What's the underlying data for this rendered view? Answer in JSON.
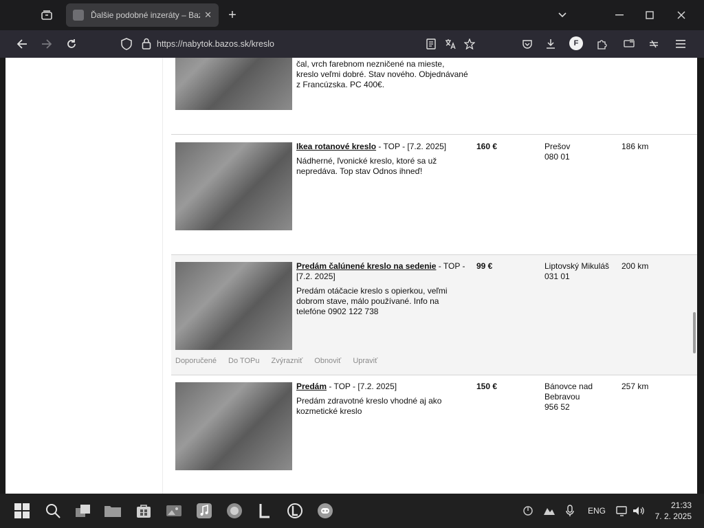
{
  "browser": {
    "tab_title": "Ďalšie podobné inzeráty – Bazoš",
    "new_tab_symbol": "+",
    "url": "https://nabytok.bazos.sk/kreslo"
  },
  "listings": [
    {
      "title": "",
      "date": "",
      "description": "čal, vrch farebnom nezničené na mieste, kreslo veľmi dobré. Stav nového. Objednávané z Francúzska. PC 400€.",
      "price": "",
      "location": "",
      "zip": "",
      "distance": ""
    },
    {
      "title": "Ikea rotanové kreslo",
      "date": "- TOP - [7.2. 2025]",
      "description": "Nádherné, ľvonické kreslo, ktoré sa už nepredáva. Top stav Odnos ihneď!",
      "price": "160 €",
      "location": "Prešov",
      "zip": "080 01",
      "distance": "186 km"
    },
    {
      "title": "Predám čalúnené kreslo na sedenie",
      "date": "- TOP - [7.2. 2025]",
      "description": "Predám otáčacie kreslo s opierkou, veľmi dobrom stave, málo používané. Info na telefóne 0902 122 738",
      "price": "99 €",
      "location": "Liptovský Mikuláš",
      "zip": "031 01",
      "distance": "200 km",
      "promo_links": [
        "Doporučené",
        "Do TOPu",
        "Zvýrazniť",
        "Obnoviť",
        "Upraviť"
      ]
    },
    {
      "title": "Predám",
      "date": "- TOP - [7.2. 2025]",
      "description": "Predám zdravotné kreslo vhodné aj ako kozmetické kreslo",
      "price": "150 €",
      "location": "Bánovce nad Bebravou",
      "zip": "956 52",
      "distance": "257 km"
    }
  ],
  "taskbar": {
    "language": "ENG",
    "time": "21:33",
    "date": "7. 2. 2025"
  }
}
